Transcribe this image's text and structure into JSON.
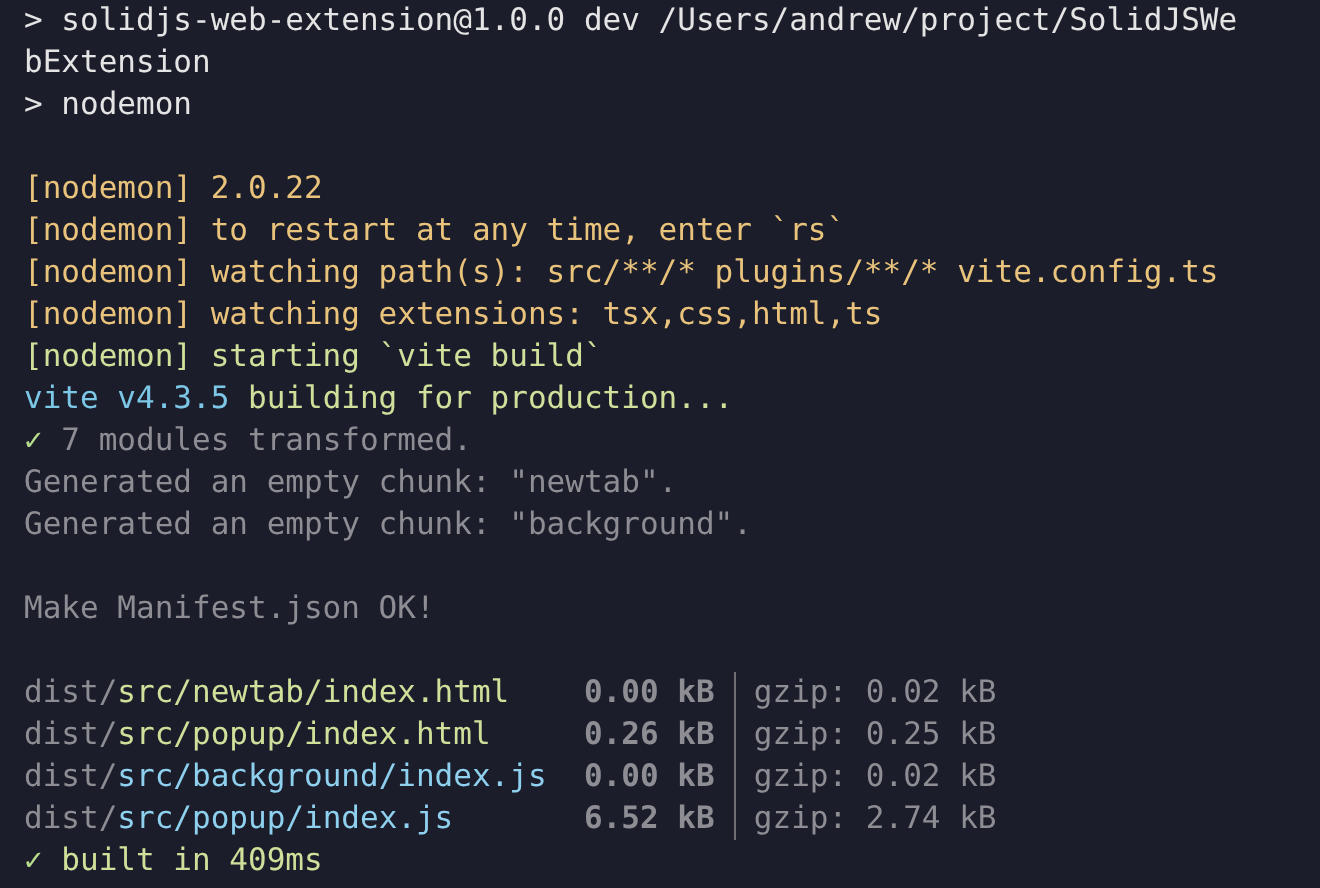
{
  "lines": [
    {
      "kind": "text",
      "segments": [
        {
          "text": "> solidjs-web-extension@1.0.0 dev /Users/andrew/project/SolidJSWe",
          "kind": "plain"
        }
      ]
    },
    {
      "kind": "text",
      "segments": [
        {
          "text": "bExtension",
          "kind": "plain"
        }
      ]
    },
    {
      "kind": "text",
      "segments": [
        {
          "text": "> nodemon",
          "kind": "plain"
        }
      ]
    },
    {
      "kind": "blank"
    },
    {
      "kind": "text",
      "segments": [
        {
          "text": "[nodemon] 2.0.22",
          "kind": "warn"
        }
      ]
    },
    {
      "kind": "text",
      "segments": [
        {
          "text": "[nodemon] to restart at any time, enter `rs`",
          "kind": "warn"
        }
      ]
    },
    {
      "kind": "text",
      "segments": [
        {
          "text": "[nodemon] watching path(s): src/**/* plugins/**/* vite.config.ts",
          "kind": "warn"
        }
      ]
    },
    {
      "kind": "text",
      "segments": [
        {
          "text": "[nodemon] watching extensions: tsx,css,html,ts",
          "kind": "warn"
        }
      ]
    },
    {
      "kind": "text",
      "segments": [
        {
          "text": "[nodemon] starting `vite build`",
          "kind": "green"
        }
      ]
    },
    {
      "kind": "text",
      "segments": [
        {
          "text": "vite v4.3.5",
          "kind": "cyan"
        },
        {
          "text": " building for production...",
          "kind": "green"
        }
      ]
    },
    {
      "kind": "text",
      "segments": [
        {
          "text": "✓",
          "kind": "check"
        },
        {
          "text": " 7 modules transformed.",
          "kind": "dim"
        }
      ]
    },
    {
      "kind": "text",
      "segments": [
        {
          "text": "Generated an empty chunk: \"newtab\".",
          "kind": "dim"
        }
      ]
    },
    {
      "kind": "text",
      "segments": [
        {
          "text": "Generated an empty chunk: \"background\".",
          "kind": "dim"
        }
      ]
    },
    {
      "kind": "blank"
    },
    {
      "kind": "text",
      "segments": [
        {
          "text": "Make Manifest.json OK!",
          "kind": "dim"
        }
      ]
    },
    {
      "kind": "blank"
    },
    {
      "kind": "table",
      "rows": [
        {
          "dir": "dist/",
          "file": "src/newtab/index.html",
          "kind": "html",
          "size": "0.00 kB",
          "gzip": "gzip: 0.02 kB"
        },
        {
          "dir": "dist/",
          "file": "src/popup/index.html",
          "kind": "html",
          "size": "0.26 kB",
          "gzip": "gzip: 0.25 kB"
        },
        {
          "dir": "dist/",
          "file": "src/background/index.js",
          "kind": "js",
          "size": "0.00 kB",
          "gzip": "gzip: 0.02 kB"
        },
        {
          "dir": "dist/",
          "file": "src/popup/index.js",
          "kind": "js",
          "size": "6.52 kB",
          "gzip": "gzip: 2.74 kB"
        }
      ]
    },
    {
      "kind": "text",
      "segments": [
        {
          "text": "✓",
          "kind": "check"
        },
        {
          "text": " built in 409ms",
          "kind": "green"
        }
      ]
    }
  ]
}
